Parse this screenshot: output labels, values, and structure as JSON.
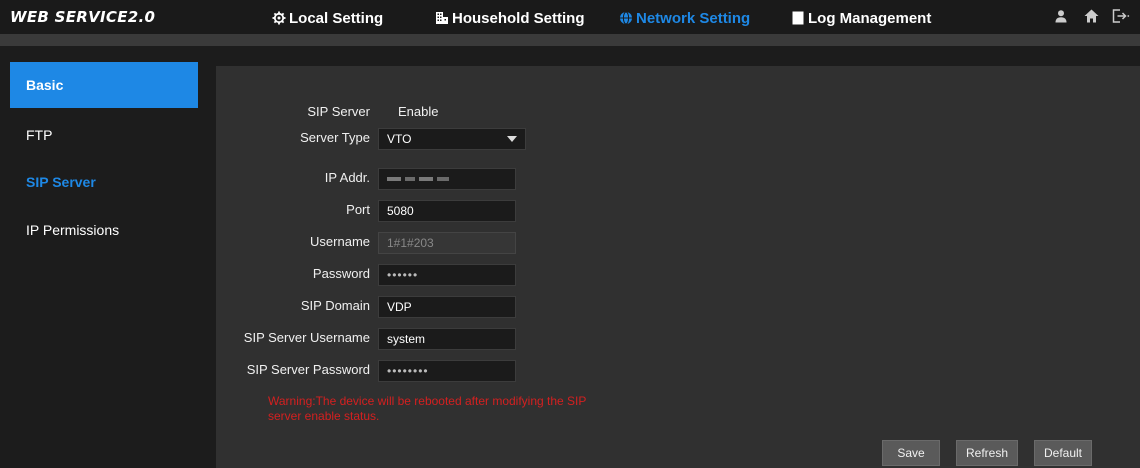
{
  "header": {
    "logo": "WEB SERVICE2.0",
    "nav": [
      {
        "label": "Local Setting",
        "icon": "gear-icon",
        "active": false
      },
      {
        "label": "Household Setting",
        "icon": "building-icon",
        "active": false
      },
      {
        "label": "Network Setting",
        "icon": "globe-icon",
        "active": true
      },
      {
        "label": "Log Management",
        "icon": "document-icon",
        "active": false
      }
    ],
    "icons": [
      "user-icon",
      "home-icon",
      "logout-icon"
    ],
    "accent_color": "#1e88e5"
  },
  "sidebar": {
    "items": [
      {
        "label": "Basic",
        "state": "selected"
      },
      {
        "label": "FTP",
        "state": "normal"
      },
      {
        "label": "SIP Server",
        "state": "current"
      },
      {
        "label": "IP Permissions",
        "state": "normal"
      }
    ]
  },
  "form": {
    "sip_server": {
      "label": "SIP Server",
      "value": "Enable"
    },
    "server_type": {
      "label": "Server Type",
      "value": "VTO"
    },
    "ip_addr": {
      "label": "IP Addr.",
      "value": ""
    },
    "port": {
      "label": "Port",
      "value": "5080"
    },
    "username": {
      "label": "Username",
      "value": "1#1#203"
    },
    "password": {
      "label": "Password",
      "value": "••••••"
    },
    "sip_domain": {
      "label": "SIP Domain",
      "value": "VDP"
    },
    "sip_server_username": {
      "label": "SIP Server Username",
      "value": "system"
    },
    "sip_server_password": {
      "label": "SIP Server Password",
      "value": "••••••••"
    },
    "warning": "Warning:The device will be rebooted after modifying the SIP server enable status."
  },
  "buttons": {
    "save": "Save",
    "refresh": "Refresh",
    "default": "Default"
  }
}
